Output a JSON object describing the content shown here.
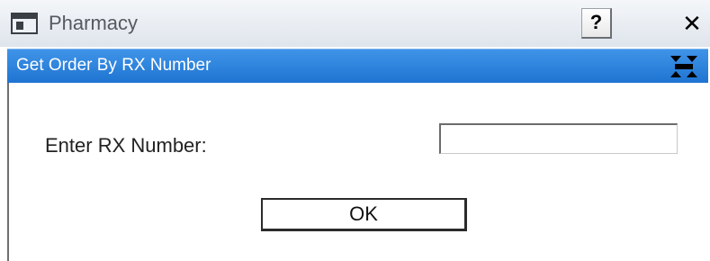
{
  "window": {
    "title": "Pharmacy",
    "help_label": "?",
    "close_label": "✕"
  },
  "header": {
    "title": "Get Order By RX Number",
    "icon": "restore-arrows-icon"
  },
  "form": {
    "rx_label": "Enter RX Number:",
    "rx_value": "",
    "ok_label": "OK"
  },
  "colors": {
    "header_band": "#2b82de",
    "header_text": "#ffffff"
  }
}
